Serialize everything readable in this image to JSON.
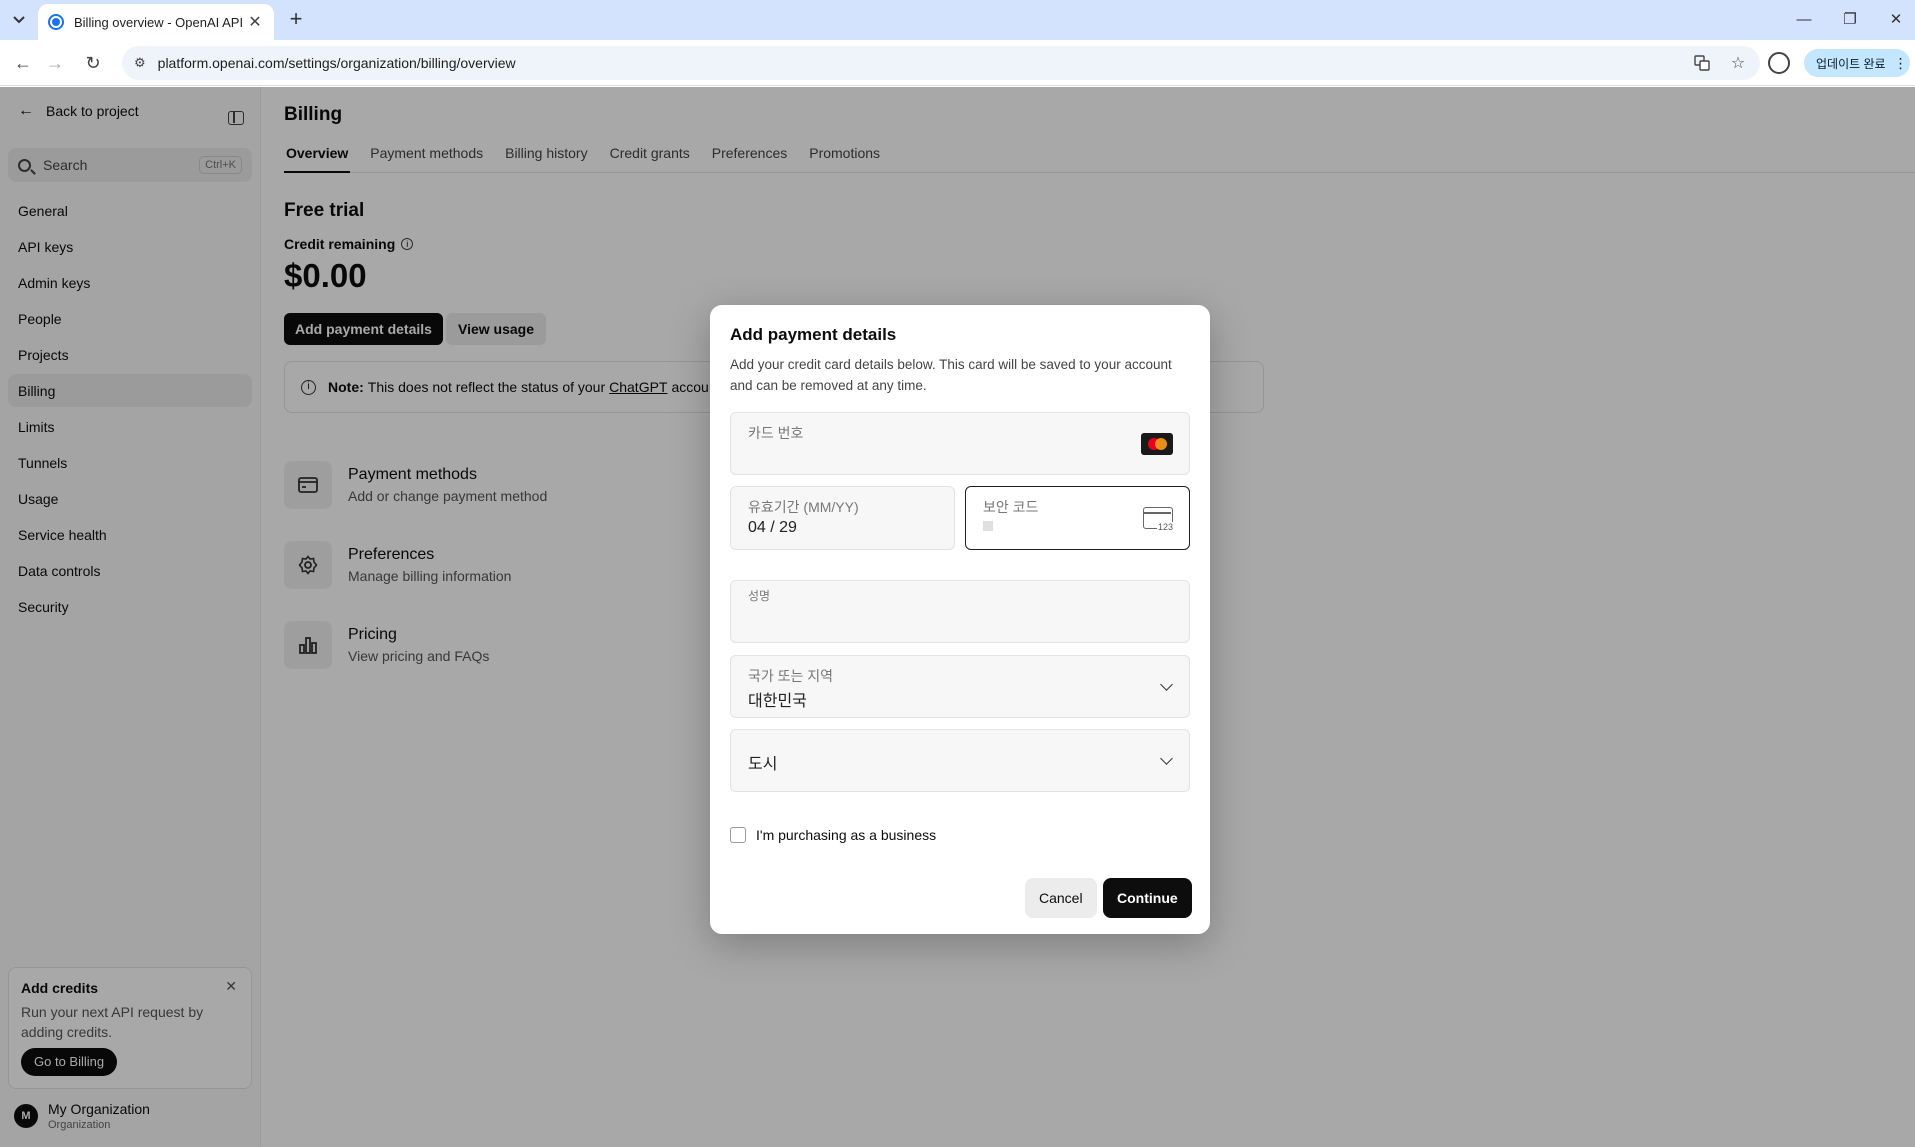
{
  "browser": {
    "tab_title": "Billing overview - OpenAI API",
    "url": "platform.openai.com/settings/organization/billing/overview",
    "update_button": "업데이트 완료",
    "minimize": "—",
    "restore": "❐",
    "close": "✕"
  },
  "sidebar": {
    "back": "Back to project",
    "search_placeholder": "Search",
    "search_shortcut": "Ctrl+K",
    "items": [
      {
        "label": "General"
      },
      {
        "label": "API keys"
      },
      {
        "label": "Admin keys"
      },
      {
        "label": "People"
      },
      {
        "label": "Projects"
      },
      {
        "label": "Billing",
        "active": true
      },
      {
        "label": "Limits"
      },
      {
        "label": "Tunnels"
      },
      {
        "label": "Usage"
      },
      {
        "label": "Service health"
      },
      {
        "label": "Data controls"
      },
      {
        "label": "Security"
      }
    ],
    "credits_card": {
      "title": "Add credits",
      "text": "Run your next API request by adding credits.",
      "button": "Go to Billing"
    },
    "org": {
      "initial": "M",
      "name": "My Organization",
      "sub": "Organization"
    }
  },
  "main": {
    "title": "Billing",
    "tabs": [
      "Overview",
      "Payment methods",
      "Billing history",
      "Credit grants",
      "Preferences",
      "Promotions"
    ],
    "active_tab": "Overview",
    "plan": "Free trial",
    "credit_label": "Credit remaining",
    "amount": "$0.00",
    "add_payment_button": "Add payment details",
    "view_usage_button": "View usage",
    "note": {
      "bold": "Note:",
      "text": "This does not reflect the status of your",
      "link": "ChatGPT",
      "tail": "accou"
    },
    "links": [
      {
        "title": "Payment methods",
        "sub": "Add or change payment method",
        "icon": "card-icon"
      },
      {
        "title": "Preferences",
        "sub": "Manage billing information",
        "icon": "gear-icon"
      },
      {
        "title": "Pricing",
        "sub": "View pricing and FAQs",
        "icon": "chart-icon"
      }
    ]
  },
  "dialog": {
    "title": "Add payment details",
    "description": "Add your credit card details below. This card will be saved to your account and can be removed at any time.",
    "card_number_label": "카드 번호",
    "expiry_label": "유효기간 (MM/YY)",
    "expiry_value": "04 / 29",
    "cvc_label": "보안 코드",
    "cvc_icon_text": "123",
    "name_label": "성명",
    "country_label": "국가 또는 지역",
    "country_value": "대한민국",
    "city_placeholder": "도시",
    "business_checkbox": "I'm purchasing as a business",
    "cancel": "Cancel",
    "continue": "Continue"
  }
}
